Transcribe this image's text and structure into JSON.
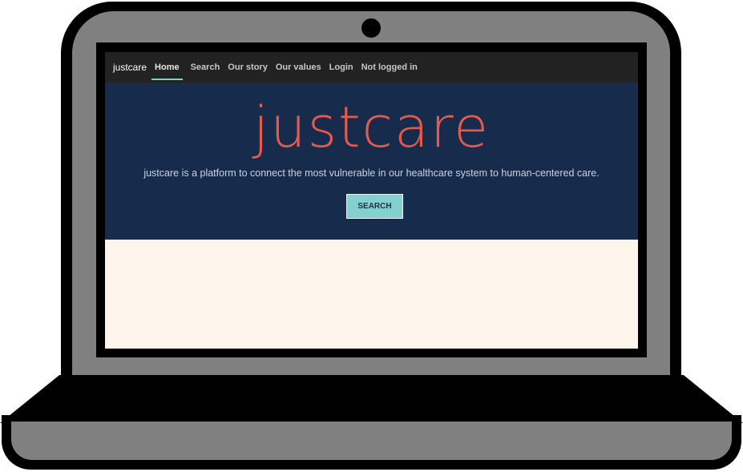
{
  "navbar": {
    "brand": "justcare",
    "items": [
      {
        "label": "Home",
        "active": true
      },
      {
        "label": "Search"
      },
      {
        "label": "Our story"
      },
      {
        "label": "Our values"
      },
      {
        "label": "Login"
      }
    ],
    "status": "Not logged in"
  },
  "hero": {
    "title": "justcare",
    "subtitle": "justcare is a platform to connect the most vulnerable in our healthcare system to human-centered care.",
    "button_label": "SEARCH"
  },
  "colors": {
    "navbar_bg": "#222222",
    "hero_bg": "#172c4c",
    "title": "#e45a4c",
    "button": "#84cfd0",
    "page_bg": "#fdf4ec"
  }
}
